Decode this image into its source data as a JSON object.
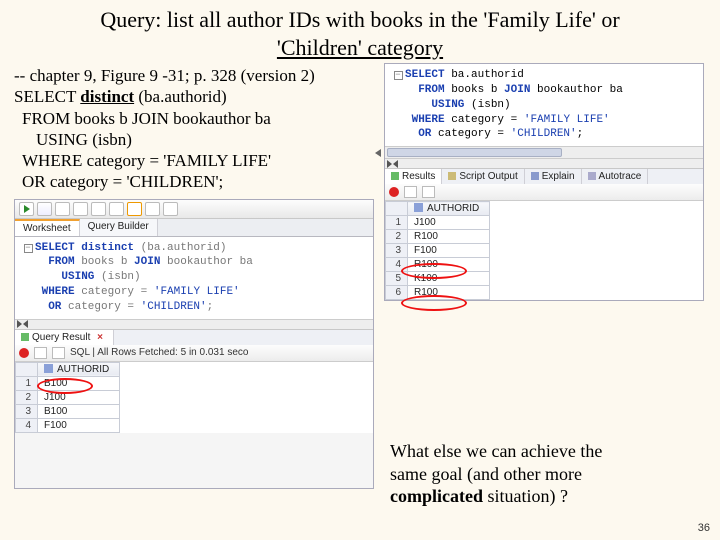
{
  "title_line1": "Query: list all author IDs with books in the 'Family Life' or",
  "title_line2": "'Children' category",
  "sql_block": {
    "l1": "-- chapter 9, Figure 9 -31; p. 328 (version 2)",
    "l2a": "SELECT ",
    "l2b": "distinct",
    "l2c": " (ba.authorid)",
    "l3": "FROM books b JOIN bookauthor ba",
    "l4": "USING (isbn)",
    "l5": "WHERE category = 'FAMILY LIFE'",
    "l6": "OR category = 'CHILDREN';"
  },
  "left_panel": {
    "tabs": {
      "worksheet": "Worksheet",
      "builder": "Query Builder"
    },
    "code": {
      "l1_kw1": "SELECT",
      "l1_kw2": "distinct",
      "l1_rest": " (ba.authorid)",
      "l2_kw": "FROM",
      "l2_rest": " books b ",
      "l2_kw2": "JOIN",
      "l2_rest2": " bookauthor ba",
      "l3_kw": "USING",
      "l3_rest": " (isbn)",
      "l4_kw": "WHERE",
      "l4_rest": " category = ",
      "l4_str": "'FAMILY LIFE'",
      "l5_kw": "OR",
      "l5_rest": " category = ",
      "l5_str": "'CHILDREN'",
      "l5_end": ";"
    },
    "result_tab": "Query Result",
    "status_prefix": "SQL  |  ",
    "status": "All Rows Fetched: 5 in 0.031 seco",
    "col_header": "AUTHORID",
    "rows": [
      {
        "n": "1",
        "v": "B100"
      },
      {
        "n": "2",
        "v": "J100"
      },
      {
        "n": "3",
        "v": "B100"
      },
      {
        "n": "4",
        "v": "F100"
      }
    ]
  },
  "right_panel": {
    "code": {
      "l1_kw": "SELECT",
      "l1_rest": " ba.authorid",
      "l2_kw": "FROM",
      "l2_rest": " books b ",
      "l2_kw2": "JOIN",
      "l2_rest2": " bookauthor ba",
      "l3_kw": "USING",
      "l3_rest": " (isbn)",
      "l4_kw": "WHERE",
      "l4_rest": " category = ",
      "l4_str": "'FAMILY LIFE'",
      "l5_kw": "OR",
      "l5_rest": " category = ",
      "l5_str": "'CHILDREN'",
      "l5_end": ";"
    },
    "tabs": {
      "results": "Results",
      "script": "Script Output",
      "explain": "Explain",
      "autotrace": "Autotrace"
    },
    "col_header": "AUTHORID",
    "rows": [
      {
        "n": "1",
        "v": "J100"
      },
      {
        "n": "2",
        "v": "R100"
      },
      {
        "n": "3",
        "v": "F100"
      },
      {
        "n": "4",
        "v": "R100"
      },
      {
        "n": "5",
        "v": "K100"
      },
      {
        "n": "6",
        "v": "R100"
      }
    ]
  },
  "question": {
    "l1": "What else we can achieve the",
    "l2": "same goal (and other more ",
    "l3a": "complicated",
    "l3b": " situation) ?"
  },
  "slide_number": "36"
}
